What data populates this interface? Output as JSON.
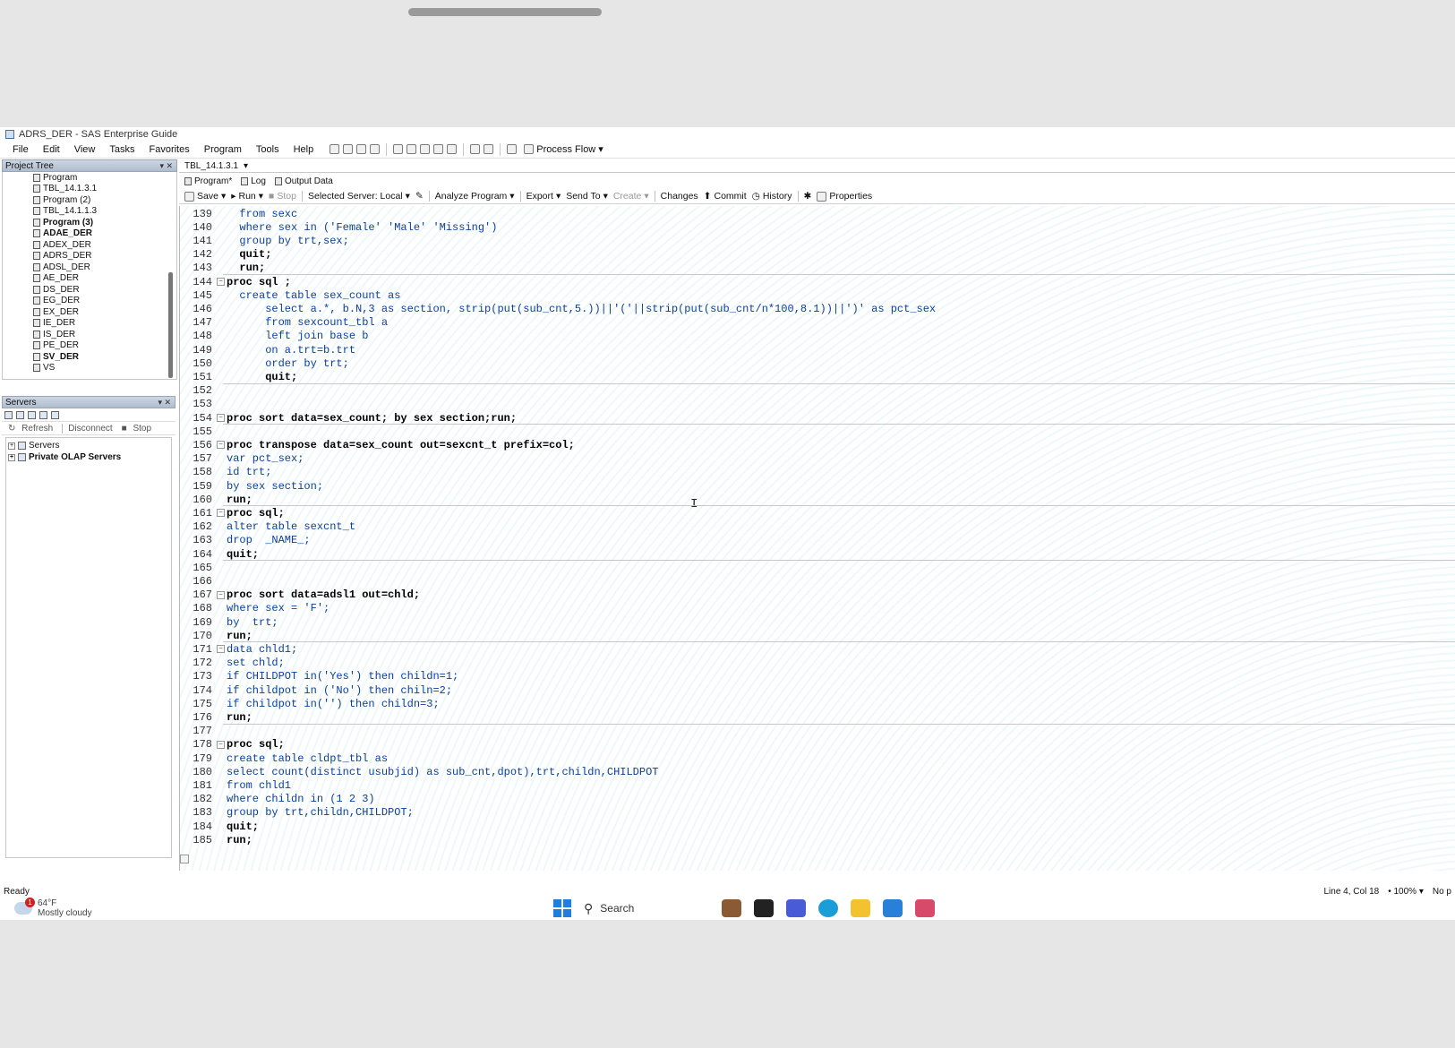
{
  "window_title": "ADRS_DER - SAS Enterprise Guide",
  "menu": [
    "File",
    "Edit",
    "View",
    "Tasks",
    "Favorites",
    "Program",
    "Tools",
    "Help"
  ],
  "toolbar": {
    "process_flow": "Process Flow"
  },
  "project_tree": {
    "title": "Project Tree",
    "items": [
      {
        "label": "Program",
        "bold": false
      },
      {
        "label": "TBL_14.1.3.1",
        "bold": false
      },
      {
        "label": "Program (2)",
        "bold": false
      },
      {
        "label": "TBL_14.1.1.3",
        "bold": false
      },
      {
        "label": "Program (3)",
        "bold": true
      },
      {
        "label": "ADAE_DER",
        "bold": true
      },
      {
        "label": "ADEX_DER",
        "bold": false
      },
      {
        "label": "ADRS_DER",
        "bold": false
      },
      {
        "label": "ADSL_DER",
        "bold": false
      },
      {
        "label": "AE_DER",
        "bold": false
      },
      {
        "label": "DS_DER",
        "bold": false
      },
      {
        "label": "EG_DER",
        "bold": false
      },
      {
        "label": "EX_DER",
        "bold": false
      },
      {
        "label": "IE_DER",
        "bold": false
      },
      {
        "label": "IS_DER",
        "bold": false
      },
      {
        "label": "PE_DER",
        "bold": false
      },
      {
        "label": "SV_DER",
        "bold": true
      },
      {
        "label": "VS",
        "bold": false
      }
    ]
  },
  "servers": {
    "title": "Servers",
    "actions": {
      "refresh": "Refresh",
      "disconnect": "Disconnect",
      "stop": "Stop"
    },
    "tree": [
      "Servers",
      "Private OLAP Servers"
    ]
  },
  "editor": {
    "doc_tab": "TBL_14.1.3.1",
    "sub_tabs": [
      "Program*",
      "Log",
      "Output Data"
    ],
    "toolbar": {
      "save": "Save",
      "run": "Run",
      "stop": "Stop",
      "server": "Selected Server: Local",
      "analyze": "Analyze Program",
      "export": "Export",
      "send_to": "Send To",
      "create": "Create",
      "changes": "Changes",
      "commit": "Commit",
      "history": "History",
      "properties": "Properties"
    },
    "lines": [
      {
        "n": "139",
        "text": "  from sexc",
        "fold": false,
        "sep": false
      },
      {
        "n": "140",
        "text": "  where sex in ('Female' 'Male' 'Missing')",
        "fold": false,
        "sep": false
      },
      {
        "n": "141",
        "text": "  group by trt,sex;",
        "fold": false,
        "sep": false
      },
      {
        "n": "142",
        "text": "  quit;",
        "fold": false,
        "sep": false
      },
      {
        "n": "143",
        "text": "  run;",
        "fold": false,
        "sep": false
      },
      {
        "n": "144",
        "text": "proc sql ;",
        "fold": true,
        "sep": true
      },
      {
        "n": "145",
        "text": "  create table sex_count as",
        "fold": false,
        "sep": false
      },
      {
        "n": "146",
        "text": "      select a.*, b.N,3 as section, strip(put(sub_cnt,5.))||'('||strip(put(sub_cnt/n*100,8.1))||')' as pct_sex",
        "fold": false,
        "sep": false
      },
      {
        "n": "147",
        "text": "      from sexcount_tbl a",
        "fold": false,
        "sep": false
      },
      {
        "n": "148",
        "text": "      left join base b",
        "fold": false,
        "sep": false
      },
      {
        "n": "149",
        "text": "      on a.trt=b.trt",
        "fold": false,
        "sep": false
      },
      {
        "n": "150",
        "text": "      order by trt;",
        "fold": false,
        "sep": false
      },
      {
        "n": "151",
        "text": "      quit;",
        "fold": false,
        "sep": false
      },
      {
        "n": "152",
        "text": "",
        "fold": false,
        "sep": true
      },
      {
        "n": "153",
        "text": "",
        "fold": false,
        "sep": false
      },
      {
        "n": "154",
        "text": "proc sort data=sex_count; by sex section;run;",
        "fold": true,
        "sep": false
      },
      {
        "n": "155",
        "text": "",
        "fold": false,
        "sep": true
      },
      {
        "n": "156",
        "text": "proc transpose data=sex_count out=sexcnt_t prefix=col;",
        "fold": true,
        "sep": false
      },
      {
        "n": "157",
        "text": "var pct_sex;",
        "fold": false,
        "sep": false
      },
      {
        "n": "158",
        "text": "id trt;",
        "fold": false,
        "sep": false
      },
      {
        "n": "159",
        "text": "by sex section;",
        "fold": false,
        "sep": false
      },
      {
        "n": "160",
        "text": "run;",
        "fold": false,
        "sep": false
      },
      {
        "n": "161",
        "text": "proc sql;",
        "fold": true,
        "sep": true
      },
      {
        "n": "162",
        "text": "alter table sexcnt_t",
        "fold": false,
        "sep": false
      },
      {
        "n": "163",
        "text": "drop  _NAME_;",
        "fold": false,
        "sep": false
      },
      {
        "n": "164",
        "text": "quit;",
        "fold": false,
        "sep": false
      },
      {
        "n": "165",
        "text": "",
        "fold": false,
        "sep": true
      },
      {
        "n": "166",
        "text": "",
        "fold": false,
        "sep": false
      },
      {
        "n": "167",
        "text": "proc sort data=adsl1 out=chld;",
        "fold": true,
        "sep": false
      },
      {
        "n": "168",
        "text": "where sex = 'F';",
        "fold": false,
        "sep": false
      },
      {
        "n": "169",
        "text": "by  trt;",
        "fold": false,
        "sep": false
      },
      {
        "n": "170",
        "text": "run;",
        "fold": false,
        "sep": false
      },
      {
        "n": "171",
        "text": "data chld1;",
        "fold": true,
        "sep": true
      },
      {
        "n": "172",
        "text": "set chld;",
        "fold": false,
        "sep": false
      },
      {
        "n": "173",
        "text": "if CHILDPOT in('Yes') then childn=1;",
        "fold": false,
        "sep": false
      },
      {
        "n": "174",
        "text": "if childpot in ('No') then chiln=2;",
        "fold": false,
        "sep": false
      },
      {
        "n": "175",
        "text": "if childpot in('') then childn=3;",
        "fold": false,
        "sep": false
      },
      {
        "n": "176",
        "text": "run;",
        "fold": false,
        "sep": false
      },
      {
        "n": "177",
        "text": "",
        "fold": false,
        "sep": true
      },
      {
        "n": "178",
        "text": "proc sql;",
        "fold": true,
        "sep": false
      },
      {
        "n": "179",
        "text": "create table cldpt_tbl as",
        "fold": false,
        "sep": false
      },
      {
        "n": "180",
        "text": "select count(distinct usubjid) as sub_cnt,dpot),trt,childn,CHILDPOT",
        "fold": false,
        "sep": false
      },
      {
        "n": "181",
        "text": "from chld1",
        "fold": false,
        "sep": false
      },
      {
        "n": "182",
        "text": "where childn in (1 2 3)",
        "fold": false,
        "sep": false
      },
      {
        "n": "183",
        "text": "group by trt,childn,CHILDPOT;",
        "fold": false,
        "sep": false
      },
      {
        "n": "184",
        "text": "quit;",
        "fold": false,
        "sep": false
      },
      {
        "n": "185",
        "text": "run;",
        "fold": false,
        "sep": false
      }
    ]
  },
  "status": {
    "left": "Ready",
    "position": "Line 4, Col 18",
    "zoom": "100%",
    "extra": "No p"
  },
  "taskbar": {
    "temperature": "64°F",
    "weather": "Mostly cloudy",
    "badge": "1",
    "search": "Search"
  }
}
